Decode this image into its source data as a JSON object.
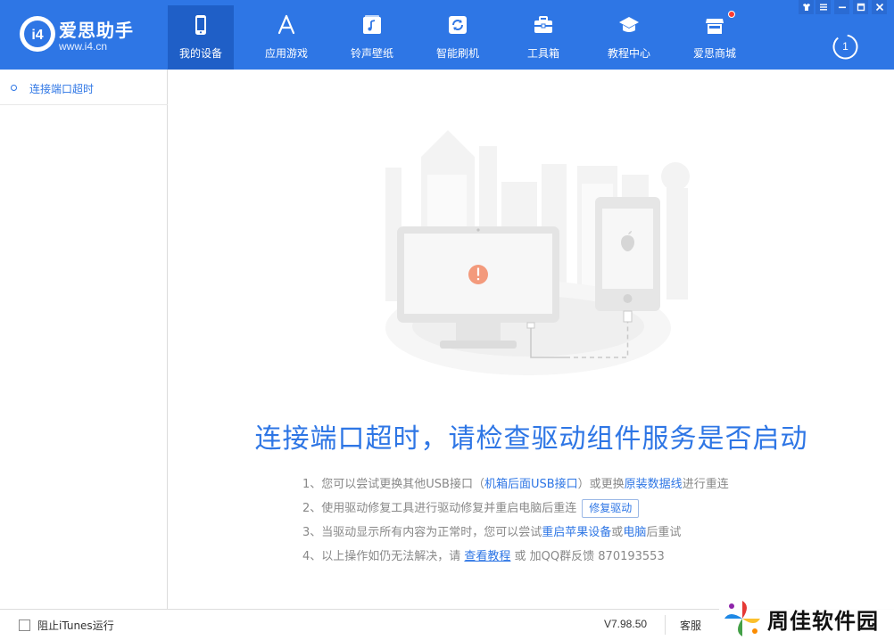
{
  "app": {
    "name": "爱思助手",
    "url": "www.i4.cn",
    "logo_glyph": "i4"
  },
  "nav": {
    "items": [
      {
        "label": "我的设备",
        "icon": "phone-icon",
        "active": true
      },
      {
        "label": "应用游戏",
        "icon": "app-store-icon"
      },
      {
        "label": "铃声壁纸",
        "icon": "music-icon"
      },
      {
        "label": "智能刷机",
        "icon": "refresh-icon"
      },
      {
        "label": "工具箱",
        "icon": "toolbox-icon"
      },
      {
        "label": "教程中心",
        "icon": "graduation-cap-icon"
      },
      {
        "label": "爱思商城",
        "icon": "shop-icon",
        "badge": true
      }
    ]
  },
  "download_count": "1",
  "window_controls": [
    "skin-icon",
    "menu-icon",
    "minimize-icon",
    "maximize-icon",
    "close-icon"
  ],
  "sidebar": {
    "items": [
      {
        "label": "连接端口超时"
      }
    ]
  },
  "main": {
    "headline": "连接端口超时，请检查驱动组件服务是否启动",
    "tips": {
      "t1": {
        "prefix": "1、您可以尝试更换其他USB接口（",
        "link1": "机箱后面USB接口",
        "mid": "）或更换",
        "link2": "原装数据线",
        "suffix": "进行重连"
      },
      "t2": {
        "text": "2、使用驱动修复工具进行驱动修复并重启电脑后重连",
        "button": "修复驱动"
      },
      "t3": {
        "prefix": "3、当驱动显示所有内容为正常时，您可以尝试",
        "link1": "重启苹果设备",
        "mid": "或",
        "link2": "电脑",
        "suffix": "后重试"
      },
      "t4": {
        "prefix": "4、以上操作如仍无法解决，请 ",
        "link": "查看教程",
        "suffix": " 或 加QQ群反馈 870193553"
      }
    }
  },
  "footer": {
    "checkbox_label": "阻止iTunes运行",
    "checkbox_checked": false,
    "version": "V7.98.50",
    "service": "客服"
  },
  "watermark": {
    "text": "周佳软件园"
  },
  "colors": {
    "brand": "#2e76e5",
    "active_nav": "#1f5fc7",
    "error_alert": "#f39a7c"
  }
}
